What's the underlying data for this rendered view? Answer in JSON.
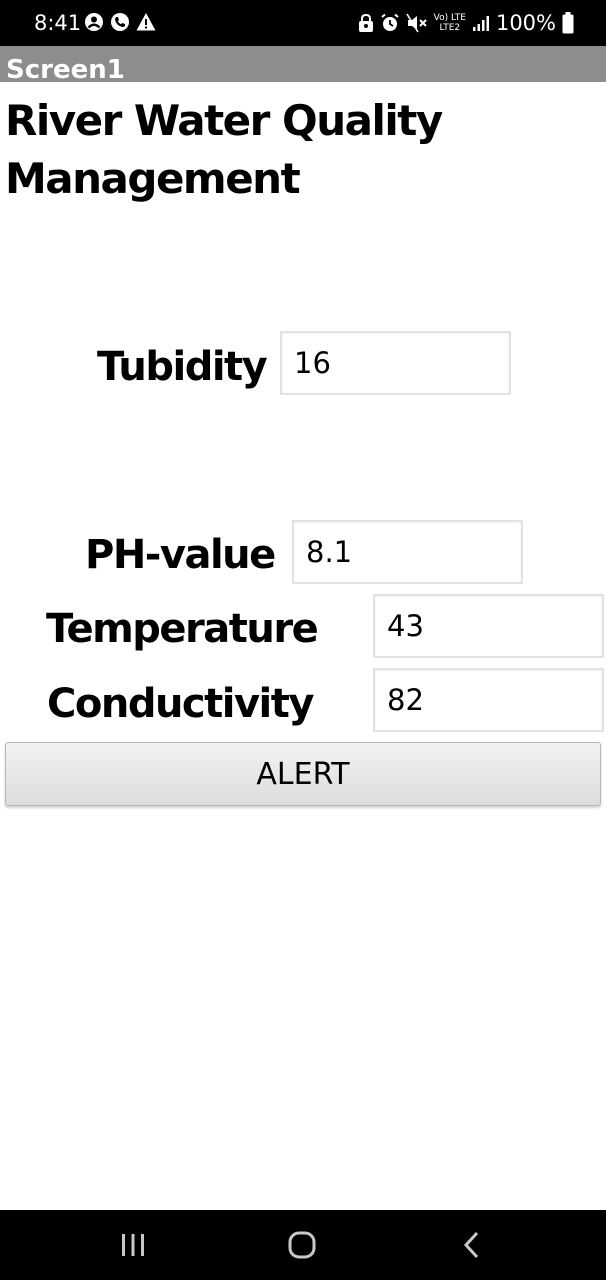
{
  "status_bar": {
    "time": "8:41",
    "battery_percent": "100%",
    "network_top": "Vo) LTE",
    "network_bottom": "LTE2",
    "icons": [
      "account-circle-icon",
      "phone-icon",
      "warning-icon",
      "lock-icon",
      "alarm-icon",
      "mute-icon",
      "signal-icon",
      "battery-icon"
    ]
  },
  "title_bar": {
    "title": "Screen1",
    "color": "#8d8d8d"
  },
  "app": {
    "heading": "River Water Quality Management"
  },
  "form": {
    "turbidity": {
      "label": "Tubidity",
      "value": "16"
    },
    "ph": {
      "label": "PH-value",
      "value": "8.1"
    },
    "temperature": {
      "label": "Temperature",
      "value": "43"
    },
    "conductivity": {
      "label": "Conductivity",
      "value": "82"
    }
  },
  "actions": {
    "alert_label": "ALERT"
  },
  "nav_bar": {
    "icons": [
      "recent-apps-icon",
      "home-icon",
      "back-icon"
    ]
  }
}
